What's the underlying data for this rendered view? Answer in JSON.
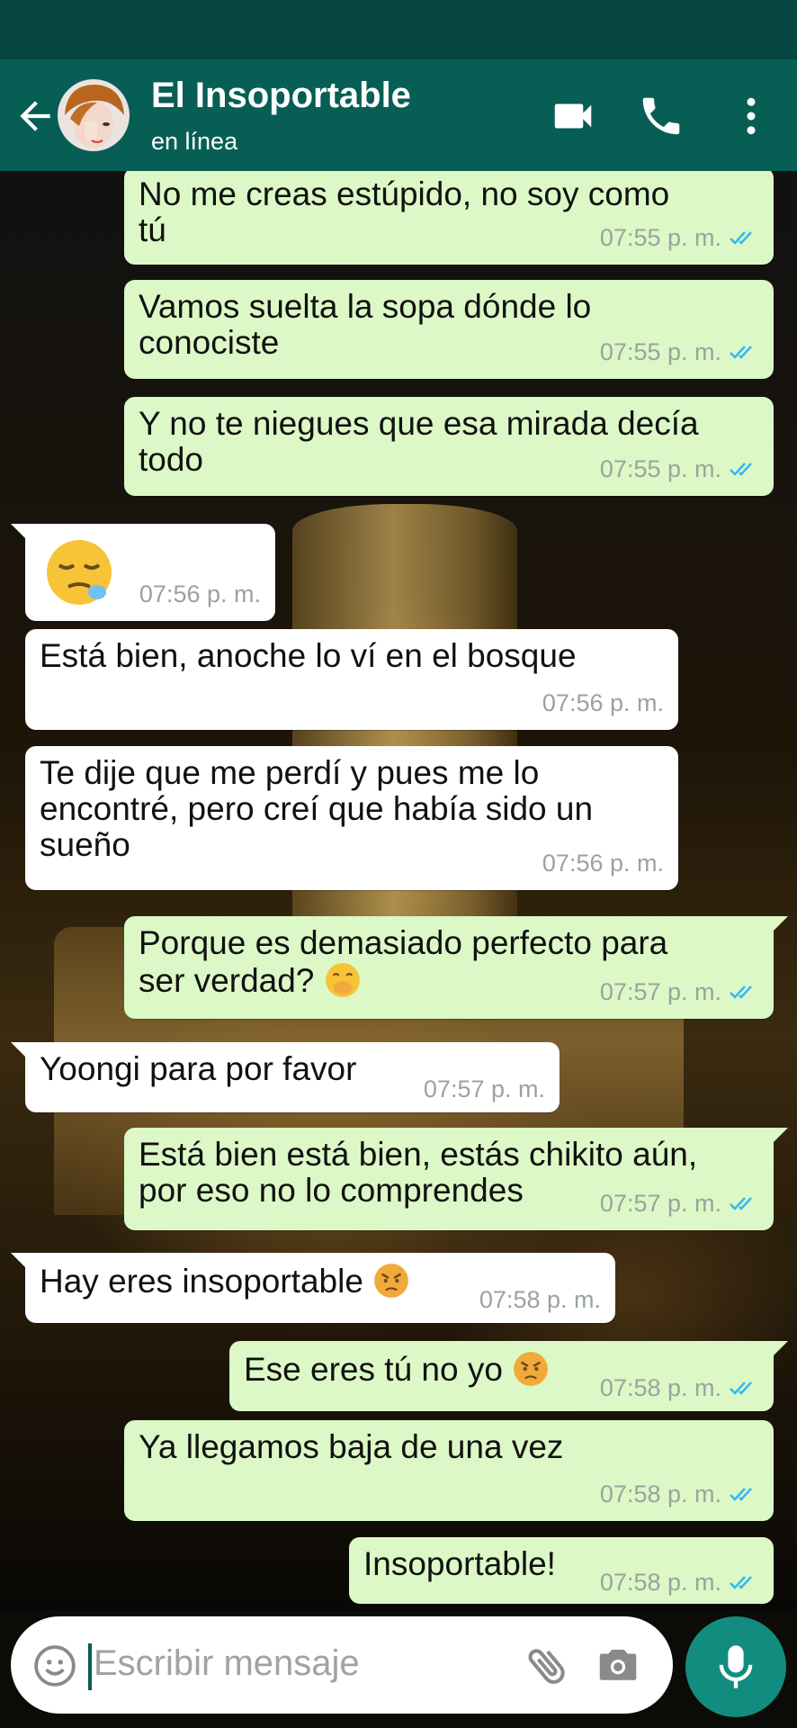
{
  "contact": {
    "name": "El Insoportable",
    "status": "en línea"
  },
  "messages": [
    {
      "dir": "out",
      "text": "No me creas estúpido, no soy como\ntú",
      "time": "07:55 p. m."
    },
    {
      "dir": "out",
      "text": "Vamos suelta la sopa dónde lo\nconociste",
      "time": "07:55 p. m."
    },
    {
      "dir": "out",
      "text": "Y no te niegues que esa mirada decía\ntodo",
      "time": "07:55 p. m."
    },
    {
      "dir": "in",
      "emoji": "sleepy-face-emoji",
      "time": "07:56 p. m."
    },
    {
      "dir": "in",
      "text": "Está bien, anoche lo ví en el bosque",
      "time": "07:56 p. m."
    },
    {
      "dir": "in",
      "text": "Te dije que me perdí y pues me lo\nencontré, pero creí que había sido un\nsueño",
      "time": "07:56 p. m."
    },
    {
      "dir": "out",
      "text": "Porque es demasiado perfecto para\nser verdad?",
      "emoji": "hand-over-mouth-emoji",
      "time": "07:57 p. m."
    },
    {
      "dir": "in",
      "text": "Yoongi para por favor",
      "time": "07:57 p. m."
    },
    {
      "dir": "out",
      "text": "Está bien está bien, estás chikito aún,\npor eso no lo comprendes",
      "time": "07:57 p. m."
    },
    {
      "dir": "in",
      "text": "Hay eres insoportable",
      "emoji": "angry-face-emoji",
      "time": "07:58 p. m."
    },
    {
      "dir": "out",
      "text": "Ese eres tú no yo",
      "emoji": "angry-face-emoji",
      "time": "07:58 p. m."
    },
    {
      "dir": "out",
      "text": "Ya llegamos baja de una vez",
      "time": "07:58 p. m."
    },
    {
      "dir": "out",
      "text": "Insoportable!",
      "time": "07:58 p. m."
    }
  ],
  "composer": {
    "placeholder": "Escribir mensaje"
  },
  "colors": {
    "header": "#075e54",
    "status_bar": "#054740",
    "outgoing": "#dcf8c6",
    "incoming": "#ffffff",
    "mic_button": "#128c7e",
    "read_ticks": "#34b7f1"
  }
}
